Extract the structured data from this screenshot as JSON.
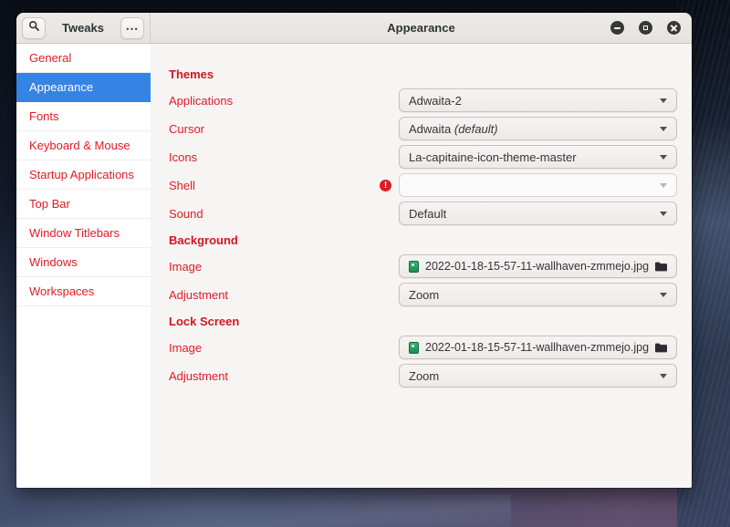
{
  "titlebar": {
    "left": {
      "app_title": "Tweaks",
      "menu_glyph": "⋯"
    },
    "right": {
      "page_title": "Appearance"
    }
  },
  "sidebar": {
    "items": [
      {
        "label": "General"
      },
      {
        "label": "Appearance",
        "selected": true
      },
      {
        "label": "Fonts"
      },
      {
        "label": "Keyboard & Mouse"
      },
      {
        "label": "Startup Applications"
      },
      {
        "label": "Top Bar"
      },
      {
        "label": "Window Titlebars"
      },
      {
        "label": "Windows"
      },
      {
        "label": "Workspaces"
      }
    ]
  },
  "content": {
    "sections": [
      {
        "title": "Themes",
        "rows": [
          {
            "label": "Applications",
            "type": "combo",
            "value": "Adwaita-2"
          },
          {
            "label": "Cursor",
            "type": "combo",
            "value": "Adwaita",
            "value_suffix": "(default)"
          },
          {
            "label": "Icons",
            "type": "combo",
            "value": "La-capitaine-icon-theme-master"
          },
          {
            "label": "Shell",
            "type": "combo_disabled",
            "value": "",
            "warning": true
          },
          {
            "label": "Sound",
            "type": "combo",
            "value": "Default"
          }
        ]
      },
      {
        "title": "Background",
        "rows": [
          {
            "label": "Image",
            "type": "file",
            "value": "2022-01-18-15-57-11-wallhaven-zmmejo.jpg"
          },
          {
            "label": "Adjustment",
            "type": "combo",
            "value": "Zoom"
          }
        ]
      },
      {
        "title": "Lock Screen",
        "rows": [
          {
            "label": "Image",
            "type": "file",
            "value": "2022-01-18-15-57-11-wallhaven-zmmejo.jpg"
          },
          {
            "label": "Adjustment",
            "type": "combo",
            "value": "Zoom"
          }
        ]
      }
    ]
  },
  "colors": {
    "accent_blue": "#3584e4",
    "label_red": "#e01b24",
    "warning_red": "#e01b24",
    "icon_green": "#2ba06a"
  },
  "icons": {
    "search": "magnifier",
    "menu": "ellipsis",
    "minimize": "bar",
    "maximize": "square",
    "close": "cross",
    "shell_warning": "exclamation-circle",
    "image_file": "green-photo-thumbnail",
    "browse": "folder"
  }
}
